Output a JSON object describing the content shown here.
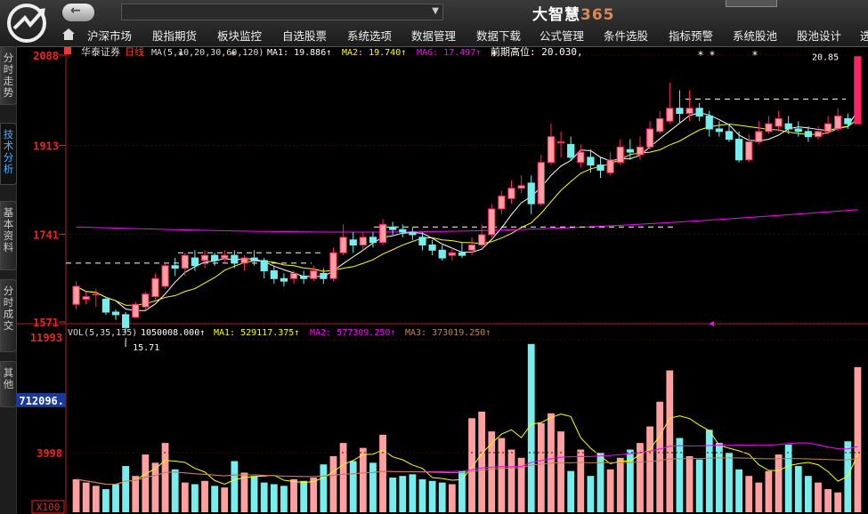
{
  "app": {
    "brand_main": "大智慧",
    "brand_num": "365",
    "nav_arrow": "←",
    "address_arrow": "▼"
  },
  "menu": [
    "沪深市场",
    "股指期货",
    "板块监控",
    "自选股票",
    "系统选项",
    "数据管理",
    "数据下载",
    "公式管理",
    "条件选股",
    "指标预警",
    "系统股池",
    "股池设计",
    "选"
  ],
  "side_tabs": [
    "分时走势",
    "技术分析",
    "基本资料",
    "分时成交",
    "其他"
  ],
  "chart_header": {
    "stock": "华泰证券",
    "period": "日线",
    "ma_def": "MA(5,10,20,30,60,120)",
    "ma1": "MA1: 19.886↑",
    "ma2": "MA2: 19.740↑",
    "ma6": "MA6: 17.497↑",
    "prev_high": "前期高位: 20.030,"
  },
  "price_axis": [
    "2088",
    "1913",
    "1741",
    "1571"
  ],
  "price_marks": {
    "high_label": "20.85",
    "low_label": "15.71"
  },
  "vol_header": {
    "def": "VOL(5,35,135)",
    "vol": "1050008.000↑",
    "ma1": "MA1: 529117.375↑",
    "ma2": "MA2: 577309.250↑",
    "ma3": "MA3: 373019.250↑"
  },
  "vol_axis": {
    "top": "11993",
    "mid": "712096.",
    "low": "3998",
    "unit": "X100"
  },
  "colors": {
    "up": "#f26",
    "up_fill": "#ff9fa0",
    "down": "#7ee",
    "ma1": "#fff",
    "ma2": "#ff0",
    "ma6": "#f0f",
    "line_brown": "#b85"
  },
  "chart_data": {
    "type": "candlestick",
    "ylim": [
      15.71,
      20.88
    ],
    "candles": [
      [
        16.05,
        16.4,
        15.95,
        16.5
      ],
      [
        16.15,
        16.2,
        16.05,
        16.3
      ],
      [
        16.25,
        16.25,
        16.0,
        16.35
      ],
      [
        16.15,
        15.9,
        15.85,
        16.2
      ],
      [
        15.9,
        15.85,
        15.75,
        15.95
      ],
      [
        15.85,
        15.6,
        15.5,
        15.9
      ],
      [
        15.8,
        16.05,
        15.78,
        16.1
      ],
      [
        16.0,
        16.25,
        15.95,
        16.3
      ],
      [
        16.2,
        16.55,
        16.15,
        16.65
      ],
      [
        16.4,
        16.8,
        16.35,
        16.85
      ],
      [
        16.8,
        16.75,
        16.6,
        16.95
      ],
      [
        16.75,
        17.0,
        16.6,
        17.05
      ],
      [
        16.95,
        16.8,
        16.7,
        17.1
      ],
      [
        16.9,
        17.0,
        16.75,
        17.1
      ],
      [
        17.0,
        16.9,
        16.8,
        17.05
      ],
      [
        16.95,
        17.0,
        16.85,
        17.1
      ],
      [
        17.0,
        16.85,
        16.75,
        17.1
      ],
      [
        16.85,
        16.95,
        16.7,
        17.0
      ],
      [
        16.95,
        16.9,
        16.8,
        17.1
      ],
      [
        16.9,
        16.7,
        16.55,
        16.95
      ],
      [
        16.7,
        16.55,
        16.45,
        16.8
      ],
      [
        16.55,
        16.5,
        16.4,
        16.65
      ],
      [
        16.55,
        16.65,
        16.45,
        16.7
      ],
      [
        16.6,
        16.55,
        16.45,
        16.7
      ],
      [
        16.55,
        16.7,
        16.5,
        16.8
      ],
      [
        16.65,
        16.55,
        16.45,
        16.75
      ],
      [
        16.55,
        17.05,
        16.5,
        17.15
      ],
      [
        17.05,
        17.35,
        17.0,
        17.6
      ],
      [
        17.3,
        17.2,
        17.05,
        17.45
      ],
      [
        17.2,
        17.35,
        17.1,
        17.45
      ],
      [
        17.35,
        17.25,
        17.15,
        17.45
      ],
      [
        17.25,
        17.6,
        17.2,
        17.7
      ],
      [
        17.55,
        17.5,
        17.4,
        17.65
      ],
      [
        17.5,
        17.45,
        17.35,
        17.6
      ],
      [
        17.45,
        17.4,
        17.3,
        17.55
      ],
      [
        17.35,
        17.2,
        17.1,
        17.45
      ],
      [
        17.2,
        17.1,
        17.0,
        17.3
      ],
      [
        17.1,
        16.95,
        16.9,
        17.2
      ],
      [
        17.0,
        17.05,
        16.9,
        17.15
      ],
      [
        17.05,
        17.0,
        16.95,
        17.25
      ],
      [
        17.1,
        17.2,
        17.0,
        17.35
      ],
      [
        17.2,
        17.4,
        17.15,
        17.6
      ],
      [
        17.4,
        17.9,
        17.35,
        18.0
      ],
      [
        17.9,
        18.15,
        17.8,
        18.25
      ],
      [
        18.1,
        18.3,
        18.0,
        18.45
      ],
      [
        18.3,
        18.35,
        18.2,
        18.55
      ],
      [
        18.4,
        18.0,
        17.8,
        18.55
      ],
      [
        18.0,
        18.8,
        17.95,
        18.95
      ],
      [
        18.8,
        19.3,
        18.75,
        19.55
      ],
      [
        19.2,
        19.2,
        18.9,
        19.4
      ],
      [
        19.15,
        18.9,
        18.85,
        19.3
      ],
      [
        18.8,
        19.0,
        18.7,
        19.15
      ],
      [
        18.9,
        18.75,
        18.6,
        19.05
      ],
      [
        18.75,
        18.65,
        18.5,
        18.9
      ],
      [
        18.6,
        18.85,
        18.55,
        19.0
      ],
      [
        18.8,
        19.1,
        18.75,
        19.25
      ],
      [
        19.05,
        19.0,
        18.85,
        19.25
      ],
      [
        18.95,
        19.1,
        18.85,
        19.3
      ],
      [
        19.1,
        19.45,
        19.05,
        19.6
      ],
      [
        19.4,
        19.65,
        19.35,
        19.8
      ],
      [
        19.6,
        19.85,
        19.55,
        20.35
      ],
      [
        19.85,
        19.75,
        19.55,
        20.2
      ],
      [
        19.75,
        19.85,
        19.6,
        20.2
      ],
      [
        19.85,
        19.7,
        19.6,
        19.95
      ],
      [
        19.7,
        19.45,
        19.3,
        19.8
      ],
      [
        19.45,
        19.4,
        19.3,
        19.6
      ],
      [
        19.4,
        19.25,
        19.2,
        19.55
      ],
      [
        19.25,
        18.85,
        18.8,
        19.4
      ],
      [
        18.85,
        19.2,
        18.8,
        19.35
      ],
      [
        19.2,
        19.4,
        19.15,
        19.6
      ],
      [
        19.4,
        19.55,
        19.35,
        19.7
      ],
      [
        19.5,
        19.65,
        19.4,
        19.8
      ],
      [
        19.55,
        19.45,
        19.35,
        19.7
      ],
      [
        19.45,
        19.4,
        19.3,
        19.6
      ],
      [
        19.4,
        19.3,
        19.2,
        19.5
      ],
      [
        19.3,
        19.4,
        19.25,
        19.5
      ],
      [
        19.4,
        19.55,
        19.35,
        19.7
      ],
      [
        19.45,
        19.7,
        19.4,
        19.85
      ],
      [
        19.65,
        19.55,
        19.45,
        19.75
      ],
      [
        19.55,
        20.85,
        19.55,
        20.85
      ]
    ],
    "volume": [
      200,
      180,
      160,
      140,
      170,
      280,
      220,
      350,
      300,
      420,
      260,
      180,
      170,
      190,
      160,
      150,
      310,
      240,
      220,
      180,
      170,
      160,
      200,
      190,
      210,
      290,
      340,
      420,
      310,
      390,
      300,
      470,
      210,
      220,
      230,
      200,
      190,
      180,
      170,
      250,
      570,
      610,
      490,
      450,
      380,
      330,
      1020,
      540,
      600,
      490,
      250,
      380,
      220,
      360,
      260,
      330,
      380,
      420,
      520,
      670,
      860,
      450,
      340,
      320,
      500,
      420,
      360,
      260,
      220,
      180,
      250,
      350,
      410,
      280,
      220,
      180,
      140,
      120,
      430,
      880
    ],
    "avg_line": [
      0.18,
      0.17,
      0.15,
      0.15,
      0.14,
      0.16,
      0.17,
      0.2,
      0.22,
      0.24,
      0.2,
      0.18
    ]
  }
}
